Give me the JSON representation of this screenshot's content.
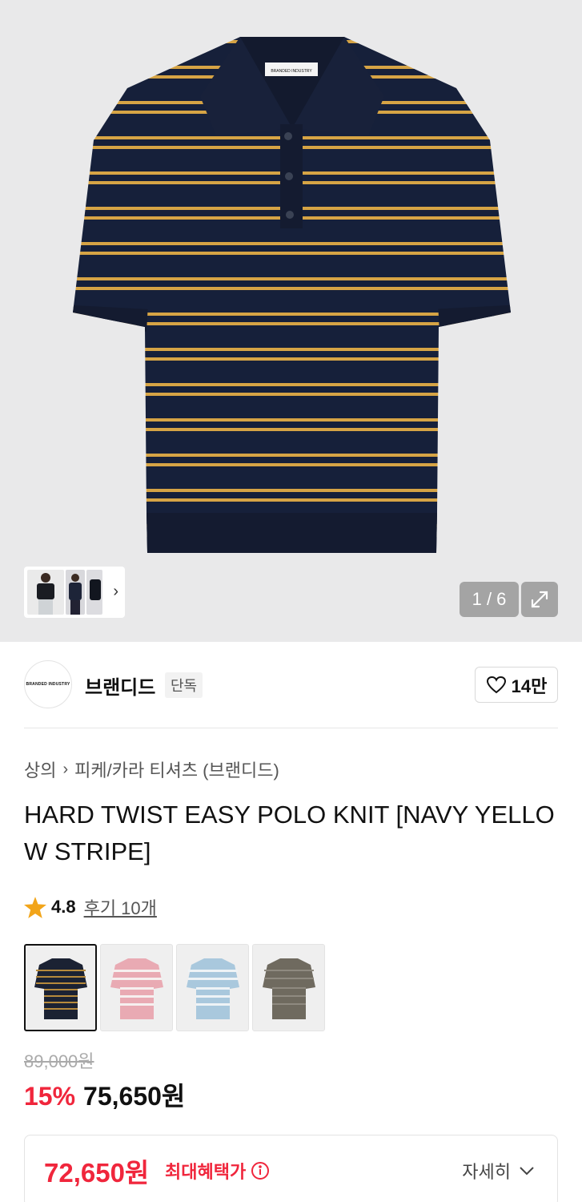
{
  "gallery": {
    "counter": "1 / 6",
    "collar_label_text": "BRANDED INDUSTRY",
    "stripe_colors": {
      "body": "#16203a",
      "stripe": "#d6a445"
    }
  },
  "brand": {
    "name": "브랜디드",
    "badge": "단독",
    "logo_text": "BRANDED INDUSTRY",
    "like_count": "14만"
  },
  "breadcrumb": [
    "상의",
    "피케/카라 티셔츠 (브랜디드)"
  ],
  "product": {
    "title": "HARD TWIST EASY POLO KNIT [NAVY YELLOW STRIPE]",
    "rating": "4.8",
    "reviews": "후기 10개"
  },
  "color_options": [
    {
      "body": "#1b2233",
      "stripe": "#b68a3c"
    },
    {
      "body": "#e9aab3",
      "stripe": "#f6f0ef"
    },
    {
      "body": "#a9c8dd",
      "stripe": "#eef3f6"
    },
    {
      "body": "#6f6a5f",
      "stripe": "#8f8a80"
    }
  ],
  "pricing": {
    "original": "89,000원",
    "discount": "15%",
    "price": "75,650원",
    "max_benefit_price": "72,650원",
    "max_benefit_label": "최대혜택가",
    "details_label": "자세히"
  },
  "colors": {
    "accent_red": "#f0263c",
    "star": "#f2a51a"
  }
}
